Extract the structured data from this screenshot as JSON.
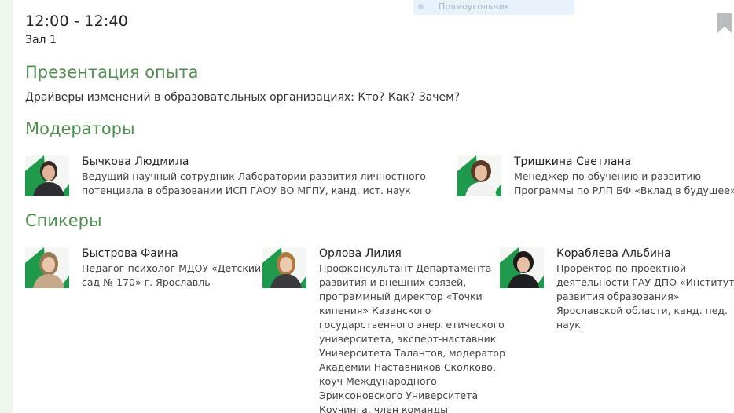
{
  "overlay_label": "Прямоугольник",
  "session": {
    "time": "12:00 - 12:40",
    "hall": "Зал 1",
    "format": "Презентация опыта",
    "topic": "Драйверы изменений в образовательных организациях: Кто? Как? Зачем?"
  },
  "moderators_heading": "Модераторы",
  "moderators": [
    {
      "name": "Бычкова Людмила",
      "role_lines": [
        "Ведущий научный сотрудник Лаборатории развития личностного",
        "потенциала в образовании ИСП ГАОУ ВО МГПУ, канд. ист. наук"
      ]
    },
    {
      "name": "Тришкина Светлана",
      "role_lines": [
        "Менеджер по обучению и развитию",
        "Программы по РЛП БФ «Вклад в будущее»"
      ]
    }
  ],
  "speakers_heading": "Спикеры",
  "speakers": [
    {
      "name": "Быстрова Фаина",
      "role_lines": [
        "Педагог-психолог МДОУ «Детский",
        "сад № 170» г. Ярославль"
      ]
    },
    {
      "name": "Орлова Лилия",
      "role_lines": [
        "Профконсультант Департамента",
        "развития и внешних связей,",
        "программный директор «Точки",
        "кипения» Казанского",
        "государственного энергетического",
        "университета, эксперт-наставник",
        "Университета Талантов, модератор",
        "Академии Наставников Сколково,",
        "коуч Международного",
        "Эриксоновского Университета",
        "Коучинга, член команды"
      ]
    },
    {
      "name": "Кораблева Альбина",
      "role_lines": [
        "Проректор по проектной",
        "деятельности ГАУ ДПО «Институт",
        "развития образования»",
        "Ярославской области, канд. пед.",
        "наук"
      ]
    }
  ],
  "colors": {
    "accent_green": "#4f8f4f",
    "photo_corner_green": "#1f9a4c"
  },
  "icons": {
    "bookmark": "bookmark-icon"
  }
}
